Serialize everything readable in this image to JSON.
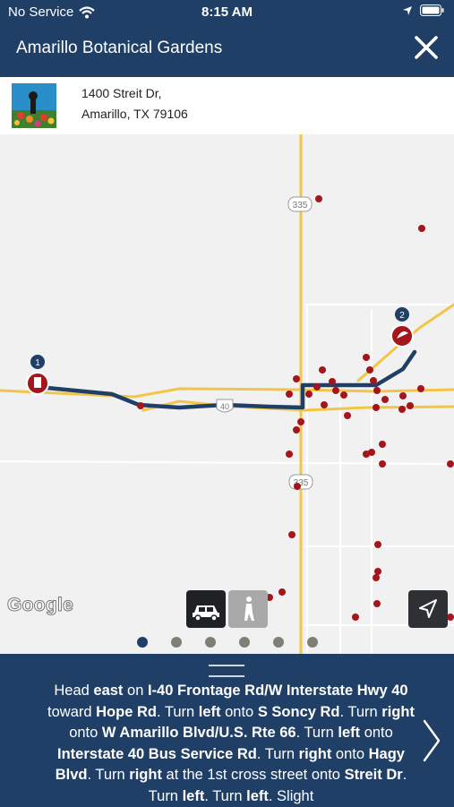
{
  "status_bar": {
    "carrier": "No Service",
    "time": "8:15 AM"
  },
  "header": {
    "title": "Amarillo Botanical Gardens"
  },
  "address": {
    "line1": "1400 Streit Dr,",
    "line2": "Amarillo, TX 79106"
  },
  "map": {
    "shields": {
      "top": "335",
      "interstate": "40",
      "bottom": "335"
    },
    "markers": [
      {
        "label": "1"
      },
      {
        "label": "2"
      }
    ],
    "attribution": "Google"
  },
  "modes": [
    {
      "name": "car",
      "selected": true
    },
    {
      "name": "walk",
      "selected": false
    }
  ],
  "pagination": {
    "count": 6,
    "active": 0
  },
  "directions": [
    {
      "text": "Head ",
      "b": false
    },
    {
      "text": "east",
      "b": true
    },
    {
      "text": " on ",
      "b": false
    },
    {
      "text": "I-40 Frontage Rd/W Interstate Hwy 40",
      "b": true
    },
    {
      "text": " toward ",
      "b": false
    },
    {
      "text": "Hope Rd",
      "b": true
    },
    {
      "text": ". Turn ",
      "b": false
    },
    {
      "text": "left",
      "b": true
    },
    {
      "text": " onto ",
      "b": false
    },
    {
      "text": "S Soncy Rd",
      "b": true
    },
    {
      "text": ". Turn ",
      "b": false
    },
    {
      "text": "right",
      "b": true
    },
    {
      "text": " onto ",
      "b": false
    },
    {
      "text": "W Amarillo Blvd/U.S. Rte 66",
      "b": true
    },
    {
      "text": ". Turn ",
      "b": false
    },
    {
      "text": "left",
      "b": true
    },
    {
      "text": " onto ",
      "b": false
    },
    {
      "text": "Interstate 40 Bus Service Rd",
      "b": true
    },
    {
      "text": ". Turn ",
      "b": false
    },
    {
      "text": "right",
      "b": true
    },
    {
      "text": " onto ",
      "b": false
    },
    {
      "text": "Hagy Blvd",
      "b": true
    },
    {
      "text": ". Turn ",
      "b": false
    },
    {
      "text": "right",
      "b": true
    },
    {
      "text": " at the 1st cross street onto ",
      "b": false
    },
    {
      "text": "Streit Dr",
      "b": true
    },
    {
      "text": ". Turn ",
      "b": false
    },
    {
      "text": "left",
      "b": true
    },
    {
      "text": ". Turn ",
      "b": false
    },
    {
      "text": "left",
      "b": true
    },
    {
      "text": ". Slight",
      "b": false
    }
  ],
  "colors": {
    "navy": "#1f3f66",
    "route": "#1f3f66",
    "road": "#f3c546",
    "poi": "#a5151c"
  }
}
